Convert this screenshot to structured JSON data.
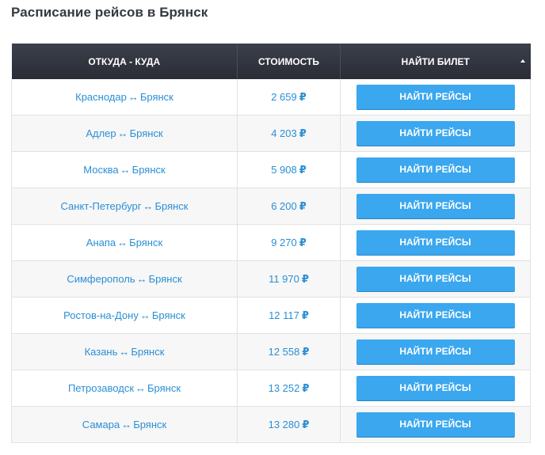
{
  "page_title": "Расписание рейсов в Брянск",
  "table": {
    "headers": {
      "route": "ОТКУДА - КУДА",
      "price": "СТОИМОСТЬ",
      "action": "НАЙТИ БИЛЕТ"
    },
    "currency_symbol": "₽",
    "arrow_symbol": "↔",
    "rows": [
      {
        "from": "Краснодар",
        "to": "Брянск",
        "price": "2 659",
        "button": "НАЙТИ РЕЙСЫ"
      },
      {
        "from": "Адлер",
        "to": "Брянск",
        "price": "4 203",
        "button": "НАЙТИ РЕЙСЫ"
      },
      {
        "from": "Москва",
        "to": "Брянск",
        "price": "5 908",
        "button": "НАЙТИ РЕЙСЫ"
      },
      {
        "from": "Санкт-Петербург",
        "to": "Брянск",
        "price": "6 200",
        "button": "НАЙТИ РЕЙСЫ"
      },
      {
        "from": "Анапа",
        "to": "Брянск",
        "price": "9 270",
        "button": "НАЙТИ РЕЙСЫ"
      },
      {
        "from": "Симферополь",
        "to": "Брянск",
        "price": "11 970",
        "button": "НАЙТИ РЕЙСЫ"
      },
      {
        "from": "Ростов-на-Дону",
        "to": "Брянск",
        "price": "12 117",
        "button": "НАЙТИ РЕЙСЫ"
      },
      {
        "from": "Казань",
        "to": "Брянск",
        "price": "12 558",
        "button": "НАЙТИ РЕЙСЫ"
      },
      {
        "from": "Петрозаводск",
        "to": "Брянск",
        "price": "13 252",
        "button": "НАЙТИ РЕЙСЫ"
      },
      {
        "from": "Самара",
        "to": "Брянск",
        "price": "13 280",
        "button": "НАЙТИ РЕЙСЫ"
      }
    ]
  },
  "colors": {
    "header_bg": "#2f323c",
    "link": "#2a8fd6",
    "button": "#3aa7ef"
  }
}
